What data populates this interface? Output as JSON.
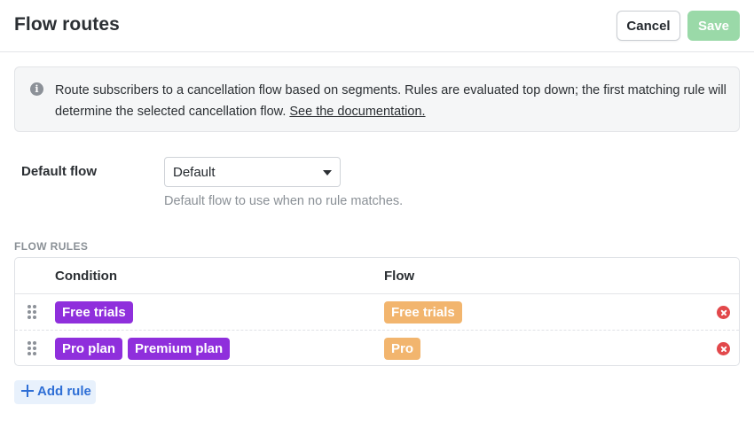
{
  "header": {
    "title": "Flow routes",
    "cancel_label": "Cancel",
    "save_label": "Save",
    "save_enabled": false
  },
  "info": {
    "icon": "info-icon",
    "text": "Route subscribers to a cancellation flow based on segments. Rules are evaluated top down; the first matching rule will determine the selected cancellation flow. ",
    "link_text": "See the documentation."
  },
  "default_flow": {
    "label": "Default flow",
    "selected": "Default",
    "helper": "Default flow to use when no rule matches."
  },
  "flow_rules": {
    "section_label": "FLOW RULES",
    "columns": {
      "condition": "Condition",
      "flow": "Flow"
    },
    "rows": [
      {
        "conditions": [
          "Free trials"
        ],
        "flow": "Free trials"
      },
      {
        "conditions": [
          "Pro plan",
          "Premium plan"
        ],
        "flow": "Pro"
      }
    ],
    "add_rule_label": "Add rule"
  },
  "colors": {
    "condition_tag": "#8f2fdc",
    "flow_tag": "#f2b56e",
    "save_disabled": "#9ad9a8",
    "remove": "#e2484b",
    "add_rule_text": "#2f6fd6"
  }
}
